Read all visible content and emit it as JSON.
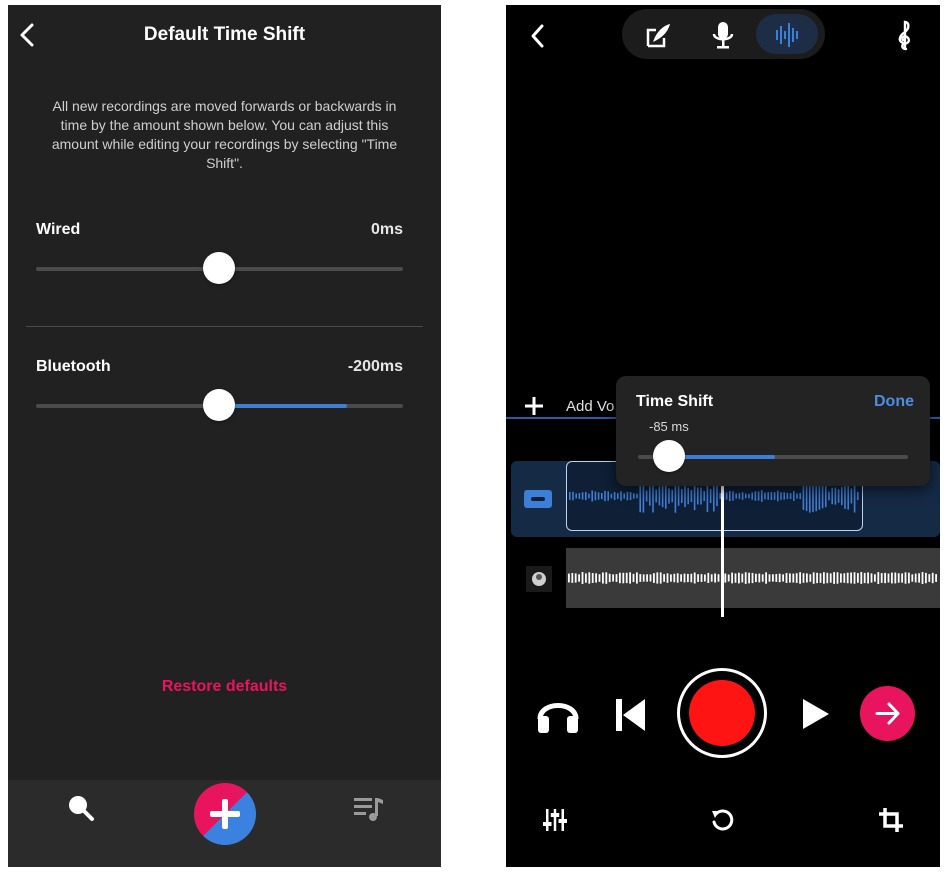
{
  "left_screen": {
    "title": "Default Time Shift",
    "description": "All new recordings are moved forwards or backwards in time by the amount shown below. You can adjust this amount while editing your recordings by selecting \"Time Shift\".",
    "wired": {
      "label": "Wired",
      "value": "0ms",
      "slider_position": 0.5
    },
    "bluetooth": {
      "label": "Bluetooth",
      "value": "-200ms",
      "slider_position": 0.5,
      "fill_end": 0.85
    },
    "restore_label": "Restore defaults",
    "bottom_nav": {
      "icons": [
        "search-icon",
        "plus-icon",
        "playlist-music-icon"
      ]
    },
    "colors": {
      "accent_pink": "#e8155e",
      "accent_blue": "#3d7fd6",
      "background": "#212121"
    }
  },
  "right_screen": {
    "mode_icons": [
      "quill-icon",
      "microphone-icon",
      "waveform-icon"
    ],
    "active_mode": "waveform-icon",
    "top_right_icon": "treble-clef-icon",
    "add_track_label": "Add Vo",
    "time_shift_popup": {
      "title": "Time Shift",
      "done_label": "Done",
      "value": "-85 ms",
      "slider_position": 0.12,
      "fill_end": 0.5
    },
    "transport_icons": [
      "headphones-icon",
      "skip-back-icon",
      "record-button",
      "play-icon",
      "arrow-right-icon"
    ],
    "bottom_icons": [
      "mixer-sliders-icon",
      "undo-icon",
      "crop-icon"
    ],
    "colors": {
      "record_red": "#ff1414",
      "next_pink": "#e8155e",
      "wave_blue": "#3d7fd6"
    }
  }
}
